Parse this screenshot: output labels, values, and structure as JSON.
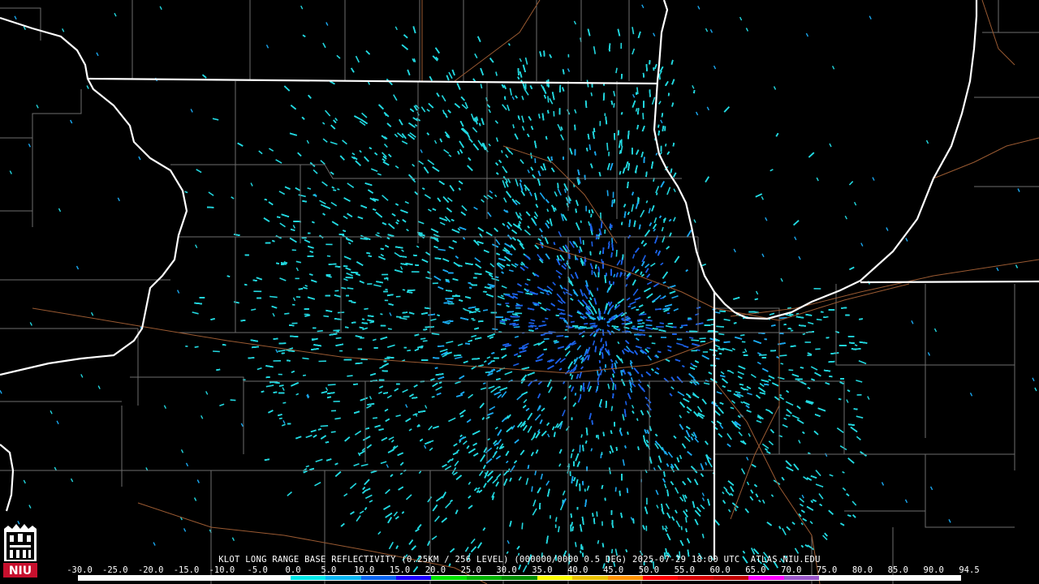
{
  "caption": "KLOT LONG RANGE BASE REFLECTIVITY (0.25KM / 256 LEVEL) (000000/0000 0.5 DEG) 2025-07-29 18:00 UTC  ATLAS.NIU.EDU",
  "scale_labels": [
    "-30.0",
    "-25.0",
    "-20.0",
    "-15.0",
    "-10.0",
    "-5.0",
    "0.0",
    "5.0",
    "10.0",
    "15.0",
    "20.0",
    "25.0",
    "30.0",
    "35.0",
    "40.0",
    "45.0",
    "50.0",
    "55.0",
    "60.0",
    "65.0",
    "70.0",
    "75.0",
    "80.0",
    "85.0",
    "90.0",
    "94.5"
  ],
  "colorbar_colors": [
    "#ffffff",
    "#ffffff",
    "#ffffff",
    "#ffffff",
    "#ffffff",
    "#ffffff",
    "#06e8e8",
    "#0ab4f0",
    "#0a64f0",
    "#1a00ff",
    "#00e000",
    "#00b000",
    "#008c00",
    "#ffff00",
    "#e8c000",
    "#ff9000",
    "#ff0000",
    "#d60000",
    "#c00000",
    "#ff00ff",
    "#9a55c8",
    "#ffffff",
    "#ffffff",
    "#ffffff",
    "#ffffff"
  ],
  "logo_text": "NIU",
  "colors": {
    "echo_light": "#22d8e0",
    "echo_mid": "#1aa8f0",
    "echo_dark": "#1c60e8",
    "state_border": "#ffffff",
    "county": "#6e6e6e",
    "road": "#9a5a32"
  }
}
